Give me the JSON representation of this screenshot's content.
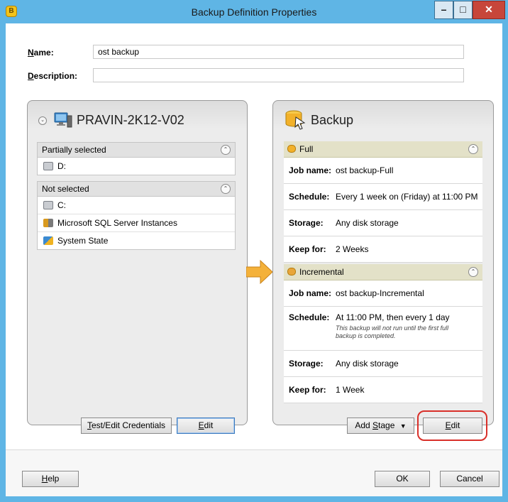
{
  "window": {
    "title": "Backup Definition Properties"
  },
  "form": {
    "name_label": "Name:",
    "name_value": "ost backup",
    "description_label": "Description:",
    "description_value": ""
  },
  "left_panel": {
    "title": "PRAVIN-2K12-V02",
    "groups": [
      {
        "header": "Partially selected",
        "items": [
          "D:"
        ]
      },
      {
        "header": "Not selected",
        "items": [
          "C:",
          "Microsoft SQL Server Instances",
          "System State"
        ]
      }
    ],
    "buttons": {
      "credentials": "Test/Edit Credentials",
      "edit": "Edit"
    }
  },
  "right_panel": {
    "title": "Backup",
    "stages": [
      {
        "name": "Full",
        "fields": [
          {
            "key": "Job name:",
            "value": "ost backup-Full"
          },
          {
            "key": "Schedule:",
            "value": "Every 1 week on (Friday) at 11:00 PM"
          },
          {
            "key": "Storage:",
            "value": "Any disk storage"
          },
          {
            "key": "Keep for:",
            "value": "2 Weeks"
          }
        ]
      },
      {
        "name": "Incremental",
        "fields": [
          {
            "key": "Job name:",
            "value": "ost backup-Incremental"
          },
          {
            "key": "Schedule:",
            "value": "At 11:00 PM, then every 1 day",
            "note": "This backup will not run until the first full backup is completed."
          },
          {
            "key": "Storage:",
            "value": "Any disk storage"
          },
          {
            "key": "Keep for:",
            "value": "1 Week"
          }
        ]
      }
    ],
    "buttons": {
      "add_stage": "Add Stage",
      "edit": "Edit"
    }
  },
  "footer": {
    "help": "Help",
    "ok": "OK",
    "cancel": "Cancel"
  },
  "colors": {
    "titlebar": "#5fb5e5",
    "stage_header": "#e3e1c8",
    "highlight": "#d9302a",
    "arrow": "#f4b13a"
  }
}
